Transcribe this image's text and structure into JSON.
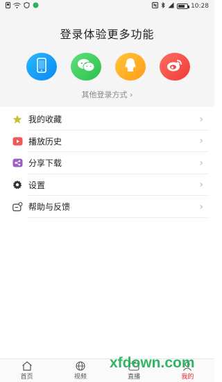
{
  "status_bar": {
    "left_icons": [
      "sim-icon",
      "wifi-icon",
      "shield-icon",
      "chat-dot-icon"
    ],
    "right_icons": [
      "nfc-icon",
      "bluetooth-icon",
      "signal-icon"
    ],
    "battery_level": 0.75,
    "time": "10:28"
  },
  "login": {
    "title": "登录体验更多功能",
    "buttons": [
      {
        "icon": "phone-icon",
        "color": "#1aa0f8"
      },
      {
        "icon": "wechat-icon",
        "color": "#3ccb5c"
      },
      {
        "icon": "qq-icon",
        "color": "#ffad24"
      },
      {
        "icon": "weibo-icon",
        "color": "#f24b43"
      }
    ],
    "other_login": "其他登录方式"
  },
  "menu": {
    "items": [
      {
        "label": "我的收藏",
        "icon": "star-icon",
        "color": "#c7c234"
      },
      {
        "label": "播放历史",
        "icon": "play-history-icon",
        "color": "#ef5a55"
      },
      {
        "label": "分享下载",
        "icon": "share-download-icon",
        "color": "#9a5fc8"
      },
      {
        "label": "设置",
        "icon": "gear-icon",
        "color": "#333333"
      },
      {
        "label": "帮助与反馈",
        "icon": "help-feedback-icon",
        "color": "#444444"
      }
    ]
  },
  "bottom_nav": {
    "items": [
      {
        "label": "首页",
        "icon": "home-icon"
      },
      {
        "label": "视频",
        "icon": "globe-icon"
      },
      {
        "label": "直播",
        "icon": "live-icon"
      },
      {
        "label": "我的",
        "icon": "profile-icon",
        "active": true
      }
    ],
    "active_color": "#e0262b"
  },
  "watermark": "xfdown.com"
}
